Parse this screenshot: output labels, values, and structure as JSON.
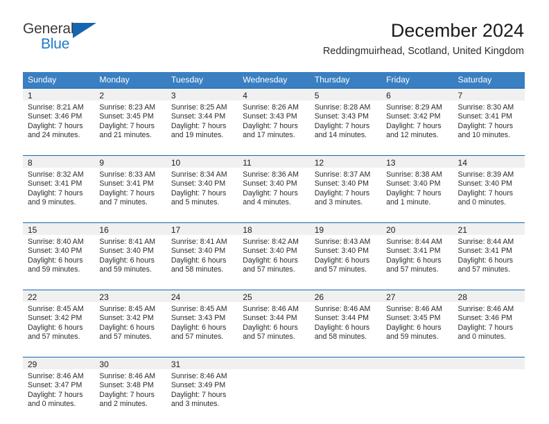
{
  "brand": {
    "line1": "General",
    "line2": "Blue",
    "triangle_color": "#1565b0",
    "text1_color": "#3b3b3b",
    "text2_color": "#1f78c8"
  },
  "header": {
    "title": "December 2024",
    "subtitle": "Reddingmuirhead, Scotland, United Kingdom"
  },
  "theme": {
    "header_bg": "#3a7fc1",
    "cell_border": "#1565b0",
    "daynum_bg": "#f0f0f0"
  },
  "calendar": {
    "weekday_headers": [
      "Sunday",
      "Monday",
      "Tuesday",
      "Wednesday",
      "Thursday",
      "Friday",
      "Saturday"
    ],
    "weeks": [
      [
        {
          "day": "1",
          "sunrise": "Sunrise: 8:21 AM",
          "sunset": "Sunset: 3:46 PM",
          "daylight1": "Daylight: 7 hours",
          "daylight2": "and 24 minutes."
        },
        {
          "day": "2",
          "sunrise": "Sunrise: 8:23 AM",
          "sunset": "Sunset: 3:45 PM",
          "daylight1": "Daylight: 7 hours",
          "daylight2": "and 21 minutes."
        },
        {
          "day": "3",
          "sunrise": "Sunrise: 8:25 AM",
          "sunset": "Sunset: 3:44 PM",
          "daylight1": "Daylight: 7 hours",
          "daylight2": "and 19 minutes."
        },
        {
          "day": "4",
          "sunrise": "Sunrise: 8:26 AM",
          "sunset": "Sunset: 3:43 PM",
          "daylight1": "Daylight: 7 hours",
          "daylight2": "and 17 minutes."
        },
        {
          "day": "5",
          "sunrise": "Sunrise: 8:28 AM",
          "sunset": "Sunset: 3:43 PM",
          "daylight1": "Daylight: 7 hours",
          "daylight2": "and 14 minutes."
        },
        {
          "day": "6",
          "sunrise": "Sunrise: 8:29 AM",
          "sunset": "Sunset: 3:42 PM",
          "daylight1": "Daylight: 7 hours",
          "daylight2": "and 12 minutes."
        },
        {
          "day": "7",
          "sunrise": "Sunrise: 8:30 AM",
          "sunset": "Sunset: 3:41 PM",
          "daylight1": "Daylight: 7 hours",
          "daylight2": "and 10 minutes."
        }
      ],
      [
        {
          "day": "8",
          "sunrise": "Sunrise: 8:32 AM",
          "sunset": "Sunset: 3:41 PM",
          "daylight1": "Daylight: 7 hours",
          "daylight2": "and 9 minutes."
        },
        {
          "day": "9",
          "sunrise": "Sunrise: 8:33 AM",
          "sunset": "Sunset: 3:41 PM",
          "daylight1": "Daylight: 7 hours",
          "daylight2": "and 7 minutes."
        },
        {
          "day": "10",
          "sunrise": "Sunrise: 8:34 AM",
          "sunset": "Sunset: 3:40 PM",
          "daylight1": "Daylight: 7 hours",
          "daylight2": "and 5 minutes."
        },
        {
          "day": "11",
          "sunrise": "Sunrise: 8:36 AM",
          "sunset": "Sunset: 3:40 PM",
          "daylight1": "Daylight: 7 hours",
          "daylight2": "and 4 minutes."
        },
        {
          "day": "12",
          "sunrise": "Sunrise: 8:37 AM",
          "sunset": "Sunset: 3:40 PM",
          "daylight1": "Daylight: 7 hours",
          "daylight2": "and 3 minutes."
        },
        {
          "day": "13",
          "sunrise": "Sunrise: 8:38 AM",
          "sunset": "Sunset: 3:40 PM",
          "daylight1": "Daylight: 7 hours",
          "daylight2": "and 1 minute."
        },
        {
          "day": "14",
          "sunrise": "Sunrise: 8:39 AM",
          "sunset": "Sunset: 3:40 PM",
          "daylight1": "Daylight: 7 hours",
          "daylight2": "and 0 minutes."
        }
      ],
      [
        {
          "day": "15",
          "sunrise": "Sunrise: 8:40 AM",
          "sunset": "Sunset: 3:40 PM",
          "daylight1": "Daylight: 6 hours",
          "daylight2": "and 59 minutes."
        },
        {
          "day": "16",
          "sunrise": "Sunrise: 8:41 AM",
          "sunset": "Sunset: 3:40 PM",
          "daylight1": "Daylight: 6 hours",
          "daylight2": "and 59 minutes."
        },
        {
          "day": "17",
          "sunrise": "Sunrise: 8:41 AM",
          "sunset": "Sunset: 3:40 PM",
          "daylight1": "Daylight: 6 hours",
          "daylight2": "and 58 minutes."
        },
        {
          "day": "18",
          "sunrise": "Sunrise: 8:42 AM",
          "sunset": "Sunset: 3:40 PM",
          "daylight1": "Daylight: 6 hours",
          "daylight2": "and 57 minutes."
        },
        {
          "day": "19",
          "sunrise": "Sunrise: 8:43 AM",
          "sunset": "Sunset: 3:40 PM",
          "daylight1": "Daylight: 6 hours",
          "daylight2": "and 57 minutes."
        },
        {
          "day": "20",
          "sunrise": "Sunrise: 8:44 AM",
          "sunset": "Sunset: 3:41 PM",
          "daylight1": "Daylight: 6 hours",
          "daylight2": "and 57 minutes."
        },
        {
          "day": "21",
          "sunrise": "Sunrise: 8:44 AM",
          "sunset": "Sunset: 3:41 PM",
          "daylight1": "Daylight: 6 hours",
          "daylight2": "and 57 minutes."
        }
      ],
      [
        {
          "day": "22",
          "sunrise": "Sunrise: 8:45 AM",
          "sunset": "Sunset: 3:42 PM",
          "daylight1": "Daylight: 6 hours",
          "daylight2": "and 57 minutes."
        },
        {
          "day": "23",
          "sunrise": "Sunrise: 8:45 AM",
          "sunset": "Sunset: 3:42 PM",
          "daylight1": "Daylight: 6 hours",
          "daylight2": "and 57 minutes."
        },
        {
          "day": "24",
          "sunrise": "Sunrise: 8:45 AM",
          "sunset": "Sunset: 3:43 PM",
          "daylight1": "Daylight: 6 hours",
          "daylight2": "and 57 minutes."
        },
        {
          "day": "25",
          "sunrise": "Sunrise: 8:46 AM",
          "sunset": "Sunset: 3:44 PM",
          "daylight1": "Daylight: 6 hours",
          "daylight2": "and 57 minutes."
        },
        {
          "day": "26",
          "sunrise": "Sunrise: 8:46 AM",
          "sunset": "Sunset: 3:44 PM",
          "daylight1": "Daylight: 6 hours",
          "daylight2": "and 58 minutes."
        },
        {
          "day": "27",
          "sunrise": "Sunrise: 8:46 AM",
          "sunset": "Sunset: 3:45 PM",
          "daylight1": "Daylight: 6 hours",
          "daylight2": "and 59 minutes."
        },
        {
          "day": "28",
          "sunrise": "Sunrise: 8:46 AM",
          "sunset": "Sunset: 3:46 PM",
          "daylight1": "Daylight: 7 hours",
          "daylight2": "and 0 minutes."
        }
      ],
      [
        {
          "day": "29",
          "sunrise": "Sunrise: 8:46 AM",
          "sunset": "Sunset: 3:47 PM",
          "daylight1": "Daylight: 7 hours",
          "daylight2": "and 0 minutes."
        },
        {
          "day": "30",
          "sunrise": "Sunrise: 8:46 AM",
          "sunset": "Sunset: 3:48 PM",
          "daylight1": "Daylight: 7 hours",
          "daylight2": "and 2 minutes."
        },
        {
          "day": "31",
          "sunrise": "Sunrise: 8:46 AM",
          "sunset": "Sunset: 3:49 PM",
          "daylight1": "Daylight: 7 hours",
          "daylight2": "and 3 minutes."
        },
        {
          "day": "",
          "sunrise": "",
          "sunset": "",
          "daylight1": "",
          "daylight2": ""
        },
        {
          "day": "",
          "sunrise": "",
          "sunset": "",
          "daylight1": "",
          "daylight2": ""
        },
        {
          "day": "",
          "sunrise": "",
          "sunset": "",
          "daylight1": "",
          "daylight2": ""
        },
        {
          "day": "",
          "sunrise": "",
          "sunset": "",
          "daylight1": "",
          "daylight2": ""
        }
      ]
    ]
  }
}
